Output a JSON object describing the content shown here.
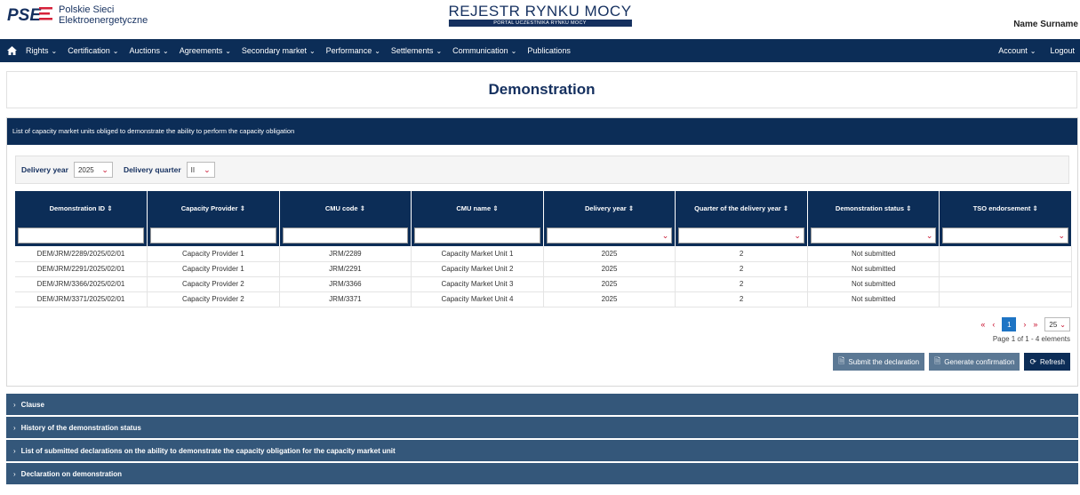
{
  "header": {
    "logo_mark": "PSE",
    "logo_line1": "Polskie Sieci",
    "logo_line2": "Elektroenergetyczne",
    "brand_title": "REJESTR RYNKU MOCY",
    "brand_subtitle": "PORTAL UCZESTNIKA RYNKU MOCY",
    "user_name": "Name Surname"
  },
  "nav": {
    "items": [
      "Rights",
      "Certification",
      "Auctions",
      "Agreements",
      "Secondary market",
      "Performance",
      "Settlements",
      "Communication",
      "Publications"
    ],
    "right_items": [
      "Account",
      "Logout"
    ]
  },
  "page_title": "Demonstration",
  "list_heading": "List of capacity market units obliged to demonstrate the ability to perform the capacity obligation",
  "filters": {
    "delivery_year_label": "Delivery year",
    "delivery_year_value": "2025",
    "delivery_quarter_label": "Delivery quarter",
    "delivery_quarter_value": "II"
  },
  "table": {
    "columns": [
      "Demonstration ID",
      "Capacity Provider",
      "CMU code",
      "CMU name",
      "Delivery year",
      "Quarter of the delivery year",
      "Demonstration status",
      "TSO endorsement"
    ],
    "rows": [
      [
        "DEM/JRM/2289/2025/02/01",
        "Capacity Provider 1",
        "JRM/2289",
        "Capacity Market Unit 1",
        "2025",
        "2",
        "Not submitted",
        ""
      ],
      [
        "DEM/JRM/2291/2025/02/01",
        "Capacity Provider 1",
        "JRM/2291",
        "Capacity Market Unit 2",
        "2025",
        "2",
        "Not submitted",
        ""
      ],
      [
        "DEM/JRM/3366/2025/02/01",
        "Capacity Provider 2",
        "JRM/3366",
        "Capacity Market Unit 3",
        "2025",
        "2",
        "Not submitted",
        ""
      ],
      [
        "DEM/JRM/3371/2025/02/01",
        "Capacity Provider 2",
        "JRM/3371",
        "Capacity Market Unit 4",
        "2025",
        "2",
        "Not submitted",
        ""
      ]
    ]
  },
  "pagination": {
    "current_page": "1",
    "page_size": "25",
    "info": "Page 1 of 1 - 4 elements"
  },
  "buttons": {
    "submit": "Submit the declaration",
    "generate": "Generate confirmation",
    "refresh": "Refresh"
  },
  "sections": [
    "Clause",
    "History of the demonstration status",
    "List of submitted declarations on the ability to demonstrate the capacity obligation for the capacity market unit",
    "Declaration on demonstration"
  ],
  "colors": {
    "navy": "#0c2d57",
    "accent_red": "#c8102e",
    "page_active": "#1e74c4"
  }
}
